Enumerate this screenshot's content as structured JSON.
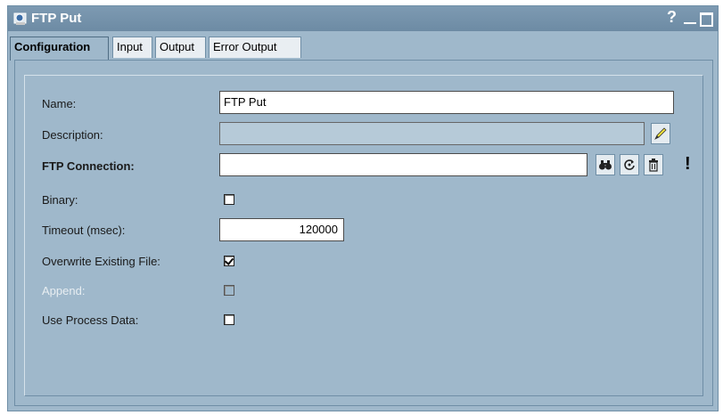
{
  "window": {
    "title": "FTP Put",
    "help_glyph": "?"
  },
  "tabs": [
    {
      "label": "Configuration",
      "active": true
    },
    {
      "label": "Input",
      "active": false
    },
    {
      "label": "Output",
      "active": false
    },
    {
      "label": "Error Output",
      "active": false
    }
  ],
  "form": {
    "name": {
      "label": "Name:",
      "value": "FTP Put"
    },
    "description": {
      "label": "Description:",
      "value": ""
    },
    "ftp_connection": {
      "label": "FTP Connection:",
      "value": "",
      "required_marker": "!"
    },
    "binary": {
      "label": "Binary:",
      "checked": false
    },
    "timeout": {
      "label": "Timeout (msec):",
      "value": "120000"
    },
    "overwrite": {
      "label": "Overwrite Existing File:",
      "checked": true
    },
    "append": {
      "label": "Append:",
      "checked": false,
      "disabled": true
    },
    "use_process_data": {
      "label": "Use Process Data:",
      "checked": false
    }
  },
  "icons": {
    "app": "ftp-app-icon",
    "edit": "pencil-icon",
    "browse": "binoculars-icon",
    "refresh": "refresh-icon",
    "delete": "trash-icon"
  }
}
